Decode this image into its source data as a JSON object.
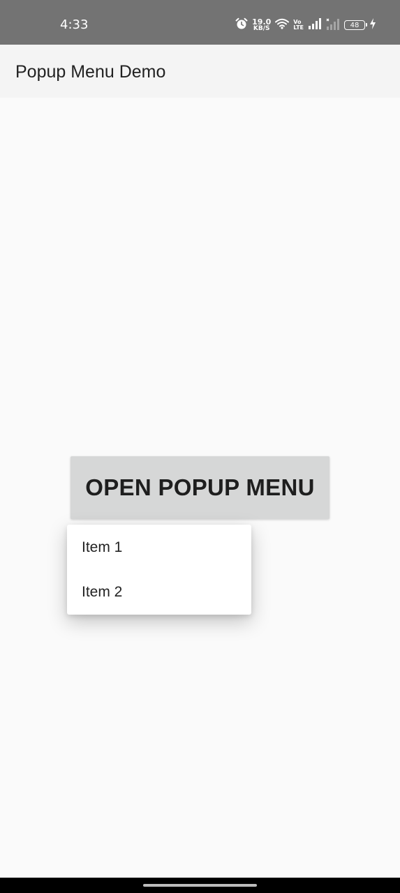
{
  "status_bar": {
    "time": "4:33",
    "network_speed_value": "19.0",
    "network_speed_unit": "KB/S",
    "volte_top": "Vo",
    "volte_bottom": "LTE",
    "battery_level": "48",
    "icons": [
      "alarm-icon",
      "network-speed-indicator",
      "wifi-icon",
      "volte-icon",
      "signal-icon",
      "signal-no-service-icon",
      "battery-icon",
      "charging-icon"
    ]
  },
  "app_bar": {
    "title": "Popup Menu Demo"
  },
  "main": {
    "button_label": "OPEN POPUP MENU"
  },
  "popup_menu": {
    "items": [
      {
        "label": "Item 1"
      },
      {
        "label": "Item 2"
      }
    ]
  },
  "colors": {
    "status_bar_bg": "#737373",
    "app_bar_bg": "#f4f4f4",
    "background": "#fafafa",
    "button_bg": "#d6d7d7",
    "menu_bg": "#ffffff",
    "text_primary": "#222222"
  }
}
